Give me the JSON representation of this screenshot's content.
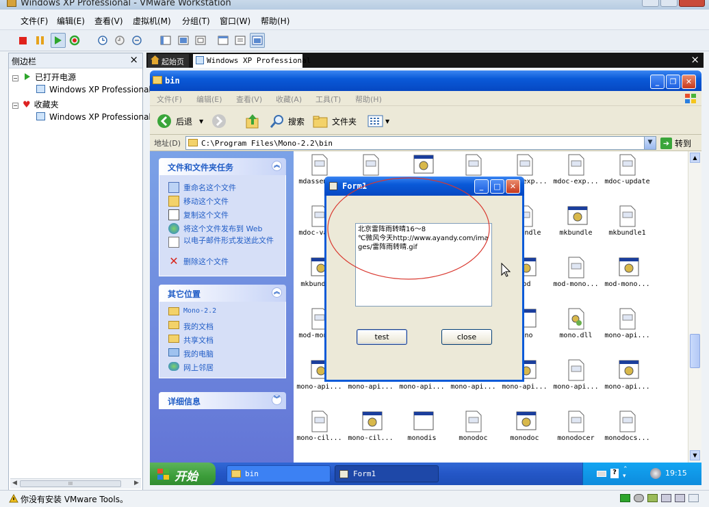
{
  "window": {
    "title": "Windows XP Professional - VMware Workstation"
  },
  "menu": [
    "文件(F)",
    "编辑(E)",
    "查看(V)",
    "虚拟机(M)",
    "分组(T)",
    "窗口(W)",
    "帮助(H)"
  ],
  "sidebar": {
    "title": "侧边栏",
    "close": "×",
    "powered_on": "已打开电源",
    "powered_on_vm": "Windows XP Professional",
    "favorites": "收藏夹",
    "favorites_vm": "Windows XP Professional",
    "scroll_thumb": "III"
  },
  "tabs": {
    "home": "起始页",
    "vm": "Windows XP Professional",
    "close": "×"
  },
  "status": {
    "text": "你没有安装 VMware Tools。"
  },
  "xp_window": {
    "title": "bin",
    "menu": [
      "文件(F)",
      "编辑(E)",
      "查看(V)",
      "收藏(A)",
      "工具(T)",
      "帮助(H)"
    ],
    "toolbar": {
      "back": "后退",
      "search": "搜索",
      "folders": "文件夹"
    },
    "address": {
      "label": "地址(D)",
      "value": "C:\\Program Files\\Mono-2.2\\bin",
      "go": "转到"
    }
  },
  "task_pane": {
    "file_tasks": {
      "title": "文件和文件夹任务",
      "items": [
        "重命名这个文件",
        "移动这个文件",
        "复制这个文件",
        "将这个文件发布到 Web",
        "以电子邮件形式发送此文件",
        "删除这个文件"
      ]
    },
    "other_places": {
      "title": "其它位置",
      "items": [
        "Mono-2.2",
        "我的文档",
        "共享文档",
        "我的电脑",
        "网上邻居"
      ]
    },
    "details": {
      "title": "详细信息"
    }
  },
  "files": [
    {
      "name": "mdassem...",
      "type": "doc"
    },
    {
      "name": "",
      "type": "doc"
    },
    {
      "name": "",
      "type": "exe"
    },
    {
      "name": "",
      "type": "doc"
    },
    {
      "name": "mdoc-exp...",
      "type": "doc"
    },
    {
      "name": "mdoc-exp...",
      "type": "doc"
    },
    {
      "name": "mdoc-update",
      "type": "doc"
    },
    {
      "name": "mdoc-va...",
      "type": "doc"
    },
    {
      "name": "",
      "type": "none"
    },
    {
      "name": "",
      "type": "none"
    },
    {
      "name": "",
      "type": "none"
    },
    {
      "name": "mkbundle",
      "type": "doc"
    },
    {
      "name": "mkbundle",
      "type": "exe"
    },
    {
      "name": "mkbundle1",
      "type": "doc"
    },
    {
      "name": "mkbund...",
      "type": "exe"
    },
    {
      "name": "",
      "type": "none"
    },
    {
      "name": "",
      "type": "none"
    },
    {
      "name": "",
      "type": "none"
    },
    {
      "name": "mod",
      "type": "exe"
    },
    {
      "name": "mod-mono...",
      "type": "doc"
    },
    {
      "name": "mod-mono...",
      "type": "exe"
    },
    {
      "name": "mod-mon...",
      "type": "doc"
    },
    {
      "name": "",
      "type": "none"
    },
    {
      "name": "",
      "type": "none"
    },
    {
      "name": "",
      "type": "none"
    },
    {
      "name": "mono",
      "type": "win"
    },
    {
      "name": "mono.dll",
      "type": "dll"
    },
    {
      "name": "mono-api...",
      "type": "doc"
    },
    {
      "name": "mono-api...",
      "type": "exe"
    },
    {
      "name": "mono-api...",
      "type": "exe"
    },
    {
      "name": "mono-api...",
      "type": "exe"
    },
    {
      "name": "mono-api...",
      "type": "exe"
    },
    {
      "name": "mono-api...",
      "type": "exe"
    },
    {
      "name": "mono-api...",
      "type": "doc"
    },
    {
      "name": "mono-api...",
      "type": "exe"
    },
    {
      "name": "mono-cil...",
      "type": "doc"
    },
    {
      "name": "mono-cil...",
      "type": "exe"
    },
    {
      "name": "monodis",
      "type": "win"
    },
    {
      "name": "monodoc",
      "type": "doc"
    },
    {
      "name": "monodoc",
      "type": "exe"
    },
    {
      "name": "monodocer",
      "type": "doc"
    },
    {
      "name": "monodocs...",
      "type": "doc"
    }
  ],
  "taskbar": {
    "start": "开始",
    "items": [
      "bin",
      "Form1"
    ],
    "clock": "19:15"
  },
  "form1": {
    "title": "Form1",
    "text": "北京雷阵雨转晴16～8\n℃微风今天http://www.ayandy.com/images/雷阵雨转晴.gif",
    "test_label": "test",
    "close_label": "close"
  },
  "colors": {
    "xp_blue": "#0a5ad8",
    "task_pane_blue": "#7ba2e7",
    "annotation_red": "#d9372e"
  }
}
